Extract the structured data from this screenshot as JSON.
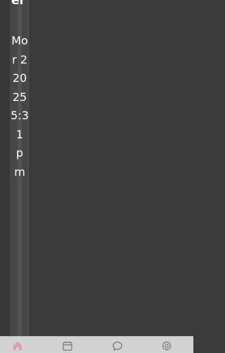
{
  "column": {
    "title_fragment": "er",
    "timestamp_text": "Mar 2 2025 5:31 pm",
    "lines": [
      "Mo",
      "r 2",
      "20",
      "25",
      "5:3",
      "1",
      "p",
      "m"
    ]
  },
  "bottom_nav": {
    "items": [
      {
        "icon": "home-icon",
        "active": true
      },
      {
        "icon": "calendar-icon",
        "active": false
      },
      {
        "icon": "chat-icon",
        "active": false
      },
      {
        "icon": "gear-icon",
        "active": false
      }
    ],
    "active_color": "#e09ab8",
    "inactive_color": "#7a7a7a"
  },
  "colors": {
    "background": "#3b3b3b",
    "nav_background": "#d2d2d2"
  }
}
